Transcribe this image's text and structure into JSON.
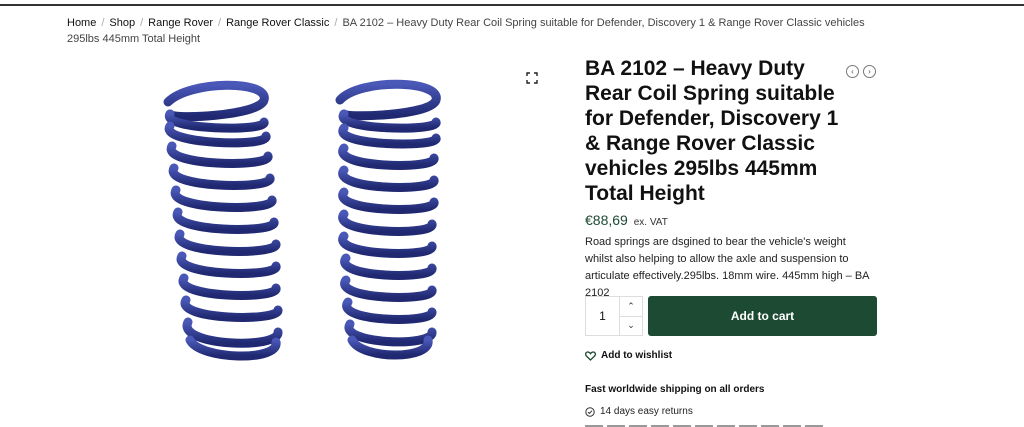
{
  "breadcrumb": {
    "items": [
      "Home",
      "Shop",
      "Range Rover",
      "Range Rover Classic"
    ],
    "current": "BA 2102 – Heavy Duty Rear Coil Spring suitable for Defender, Discovery 1 & Range Rover Classic vehicles 295lbs 445mm Total Height"
  },
  "product": {
    "title": "BA 2102 – Heavy Duty Rear Coil Spring suitable for Defender, Discovery 1 & Range Rover Classic vehicles 295lbs 445mm Total Height",
    "price": "€88,69",
    "price_suffix": "ex. VAT",
    "description": "Road springs are dsgined to bear the vehicle's weight whilst also helping to allow the axle and suspension to articulate effectively.295lbs. 18mm wire. 445mm high – BA 2102",
    "image_icon": "coil-springs-image"
  },
  "nav": {
    "prev_icon": "chevron-left-icon",
    "next_icon": "chevron-right-icon"
  },
  "gallery": {
    "expand_icon": "expand-icon"
  },
  "cart": {
    "quantity": "1",
    "add_to_cart_label": "Add to cart",
    "wishlist_label": "Add to wishlist"
  },
  "info": {
    "shipping": "Fast worldwide shipping on all orders",
    "returns": "14 days easy returns"
  },
  "colors": {
    "accent": "#1d4a33",
    "spring": "#2e3a8c",
    "price": "#1c4a34"
  }
}
